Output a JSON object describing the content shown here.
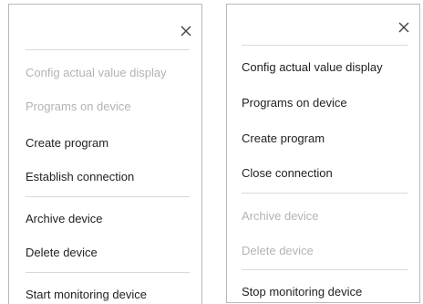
{
  "colors": {
    "enabled_text": "#222222",
    "disabled_text": "#b3b3b3",
    "divider": "#d9d9d9",
    "border": "#b9b9b9"
  },
  "left_menu": {
    "close_icon": "close-icon",
    "items": [
      {
        "label": "Config actual value display",
        "enabled": false
      },
      {
        "label": "Programs on device",
        "enabled": false
      },
      {
        "label": "Create program",
        "enabled": true
      },
      {
        "label": "Establish connection",
        "enabled": true
      },
      {
        "label": "Archive device",
        "enabled": true
      },
      {
        "label": "Delete device",
        "enabled": true
      },
      {
        "label": "Start monitoring device",
        "enabled": true
      }
    ]
  },
  "right_menu": {
    "close_icon": "close-icon",
    "items": [
      {
        "label": "Config actual value display",
        "enabled": true
      },
      {
        "label": "Programs on device",
        "enabled": true
      },
      {
        "label": "Create program",
        "enabled": true
      },
      {
        "label": "Close connection",
        "enabled": true
      },
      {
        "label": "Archive device",
        "enabled": false
      },
      {
        "label": "Delete device",
        "enabled": false
      },
      {
        "label": "Stop monitoring device",
        "enabled": true
      }
    ]
  }
}
